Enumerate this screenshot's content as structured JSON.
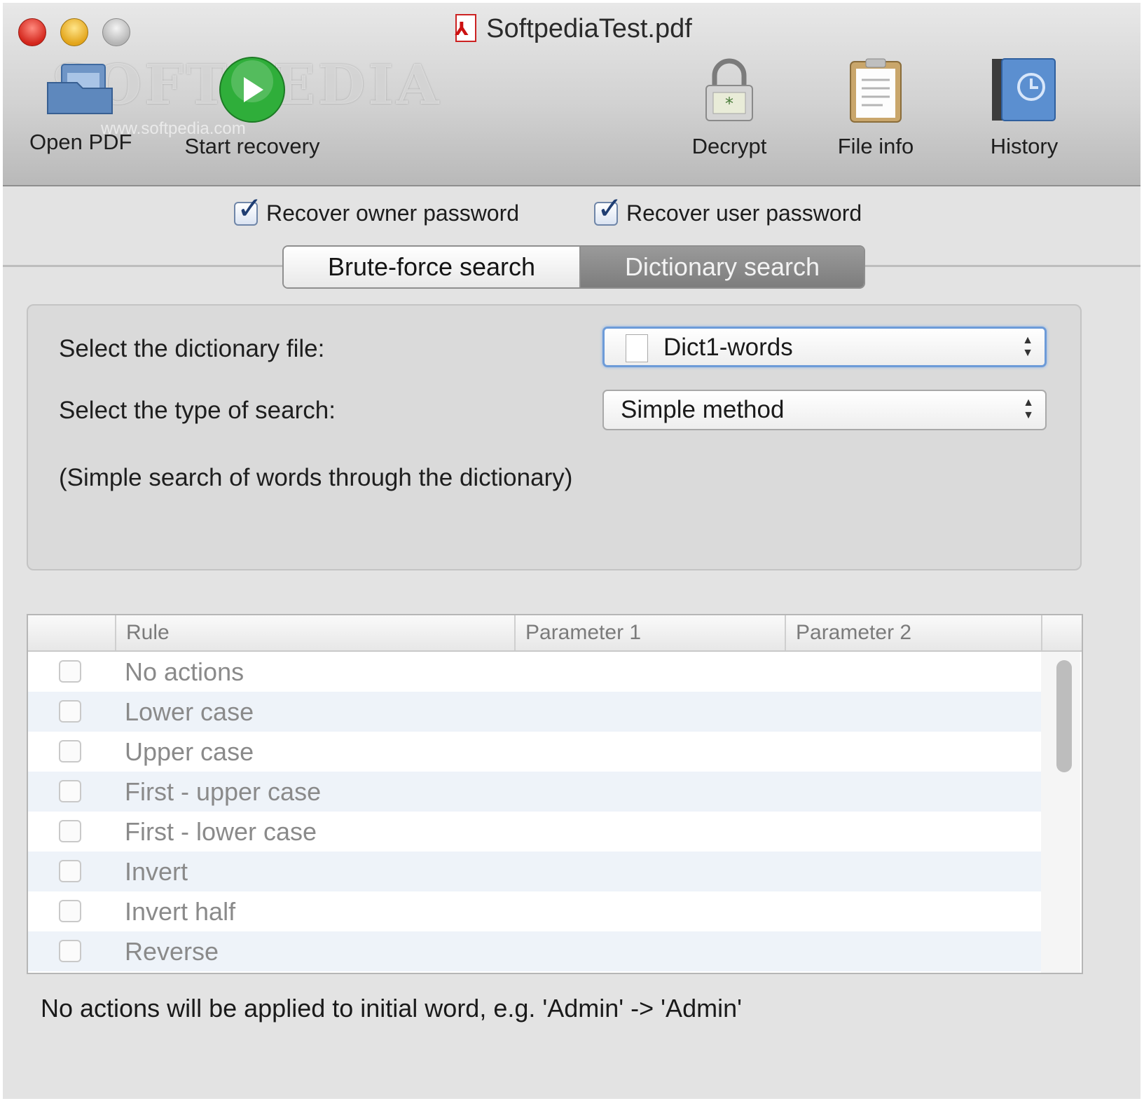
{
  "window": {
    "title": "SoftpediaTest.pdf",
    "watermark": "SOFTPEDIA",
    "watermark_url": "www.softpedia.com"
  },
  "toolbar": {
    "open_pdf": "Open PDF",
    "start_recovery": "Start recovery",
    "decrypt": "Decrypt",
    "file_info": "File info",
    "history": "History"
  },
  "options": {
    "recover_owner": {
      "label": "Recover owner password",
      "checked": true
    },
    "recover_user": {
      "label": "Recover user password",
      "checked": true
    }
  },
  "tabs": {
    "brute_force": "Brute-force search",
    "dictionary": "Dictionary search",
    "selected": "Dictionary search"
  },
  "dictionary": {
    "file_label": "Select the dictionary file:",
    "file_value": "Dict1-words",
    "type_label": "Select the type of search:",
    "type_value": "Simple method",
    "description": "(Simple search of words through the dictionary)"
  },
  "rules_table": {
    "columns": [
      "Rule",
      "Parameter 1",
      "Parameter 2"
    ],
    "rows": [
      {
        "rule": "No actions",
        "checked": false
      },
      {
        "rule": "Lower case",
        "checked": false
      },
      {
        "rule": "Upper case",
        "checked": false
      },
      {
        "rule": "First - upper case",
        "checked": false
      },
      {
        "rule": "First - lower case",
        "checked": false
      },
      {
        "rule": "Invert",
        "checked": false
      },
      {
        "rule": "Invert half",
        "checked": false
      },
      {
        "rule": "Reverse",
        "checked": false
      }
    ]
  },
  "footer": {
    "hint": "No actions will be applied to initial word, e.g. 'Admin' -> 'Admin'"
  },
  "colors": {
    "accent": "#1f3e73",
    "start_button": "#2fae3a",
    "close": "#d3261c",
    "minimize": "#e3a51b"
  }
}
